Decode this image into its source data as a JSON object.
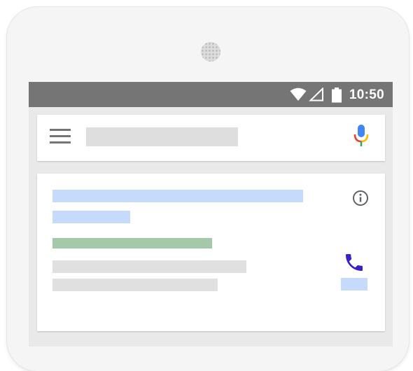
{
  "status_bar": {
    "time": "10:50",
    "icons": [
      "wifi-icon",
      "cell-signal-icon",
      "battery-icon"
    ],
    "background_color": "#757575"
  },
  "search_card": {
    "menu_icon": "menu-icon",
    "mic_icon": "mic-icon",
    "placeholder_color": "#dedede"
  },
  "result_card": {
    "info_icon": "info-icon",
    "phone_icon": "phone-icon",
    "colors": {
      "title": "#c6dafc",
      "url": "#a3c9a8",
      "text": "#e0e0e0",
      "phone": "#3b1fc9"
    }
  }
}
